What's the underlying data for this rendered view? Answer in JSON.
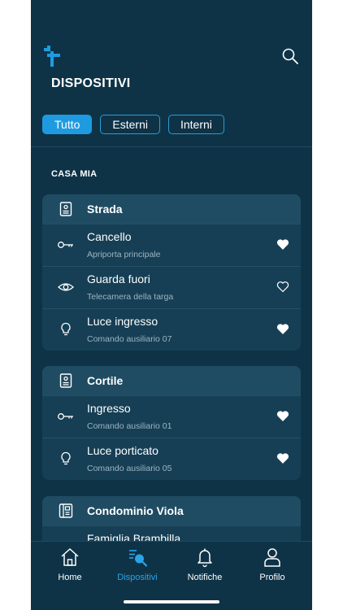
{
  "header": {
    "title": "DISPOSITIVI",
    "filters": [
      {
        "label": "Tutto",
        "active": true
      },
      {
        "label": "Esterni",
        "active": false
      },
      {
        "label": "Interni",
        "active": false
      }
    ]
  },
  "section": {
    "title": "CASA MIA"
  },
  "groups": [
    {
      "name": "Strada",
      "icon": "intercom-icon",
      "items": [
        {
          "name": "Cancello",
          "sub": "Apriporta principale",
          "icon": "key-icon",
          "favorite": true
        },
        {
          "name": "Guarda fuori",
          "sub": "Telecamera della targa",
          "icon": "eye-icon",
          "favorite": false
        },
        {
          "name": "Luce ingresso",
          "sub": "Comando ausiliario 07",
          "icon": "bulb-icon",
          "favorite": true
        }
      ]
    },
    {
      "name": "Cortile",
      "icon": "intercom-icon",
      "items": [
        {
          "name": "Ingresso",
          "sub": "Comando ausiliario 01",
          "icon": "key-icon",
          "favorite": true
        },
        {
          "name": "Luce porticato",
          "sub": "Comando ausiliario 05",
          "icon": "bulb-icon",
          "favorite": true
        }
      ]
    },
    {
      "name": "Condominio Viola",
      "icon": "building-intercom-icon",
      "items": [
        {
          "name": "Famiglia Brambilla",
          "sub": "",
          "icon": "key-icon",
          "favorite": false
        }
      ]
    }
  ],
  "tabs": [
    {
      "label": "Home",
      "icon": "home-icon",
      "active": false
    },
    {
      "label": "Dispositivi",
      "icon": "devices-search-icon",
      "active": true
    },
    {
      "label": "Notifiche",
      "icon": "bell-icon",
      "active": false
    },
    {
      "label": "Profilo",
      "icon": "user-icon",
      "active": false
    }
  ],
  "colors": {
    "background": "#0e3347",
    "card": "#163f55",
    "accent": "#1e9be0"
  }
}
